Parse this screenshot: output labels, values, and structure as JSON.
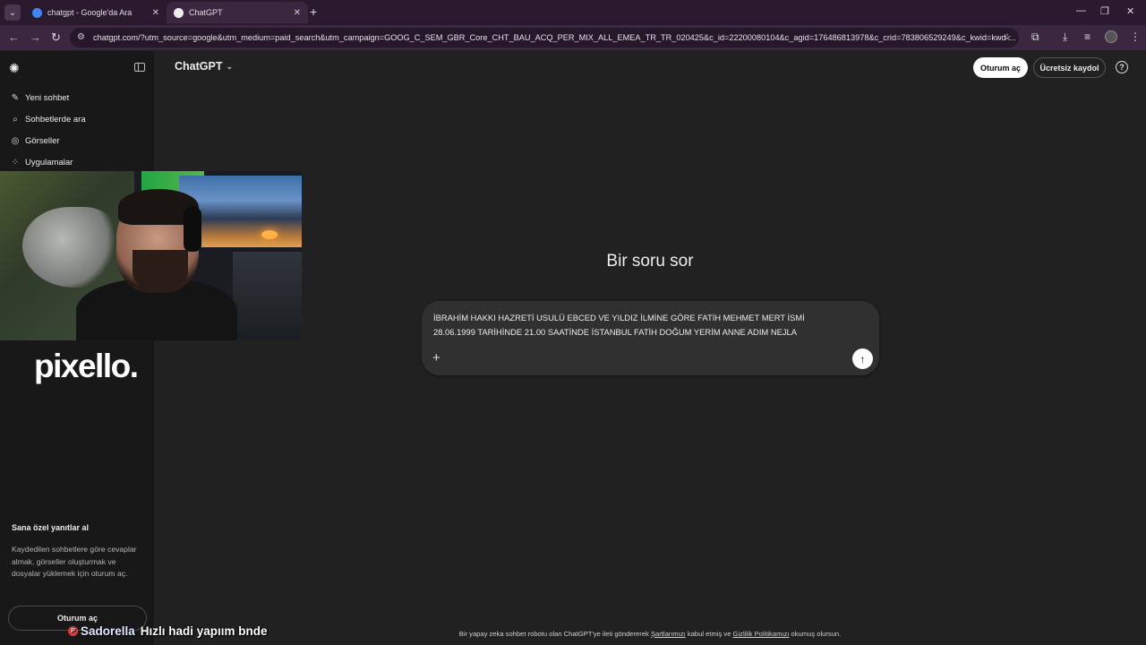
{
  "browser": {
    "tabs": [
      {
        "title": "chatgpt - Google'da Ara",
        "favicon_color": "#4285f4"
      },
      {
        "title": "ChatGPT",
        "favicon_color": "#ececec"
      }
    ],
    "url": "chatgpt.com/?utm_source=google&utm_medium=paid_search&utm_campaign=GOOG_C_SEM_GBR_Core_CHT_BAU_ACQ_PER_MIX_ALL_EMEA_TR_TR_020425&c_id=22200080104&c_agid=176486813978&c_crid=783806529249&c_kwid=kwd-...",
    "accent_color": "#3b2840"
  },
  "sidebar": {
    "items": [
      {
        "label": "Yeni sohbet",
        "icon": "edit-icon"
      },
      {
        "label": "Sohbetlerde ara",
        "icon": "search-icon"
      },
      {
        "label": "Görseller",
        "icon": "images-icon"
      },
      {
        "label": "Uygulamalar",
        "icon": "apps-icon"
      }
    ],
    "promo_title": "Sana özel yanıtlar al",
    "promo_text": "Kaydedilen sohbetlere göre cevaplar almak, görseller oluşturmak ve dosyalar yüklemek için oturum aç.",
    "login_label": "Oturum aç"
  },
  "overlay": {
    "brand": "pixello.",
    "chat_user": "Sadorella",
    "chat_message": "Hızlı hadi yapıım bnde"
  },
  "header": {
    "model_name": "ChatGPT",
    "login_label": "Oturum aç",
    "signup_label": "Ücretsiz kaydol"
  },
  "main": {
    "headline": "Bir soru sor",
    "composer_text": "İBRAHİM HAKKI HAZRETİ USULÜ EBCED VE YILDIZ İLMİNE GÖRE FATİH MEHMET MERT İSMİ 28.06.1999 TARİHİNDE 21.00 SAATİNDE İSTANBUL FATİH DOĞUM YERİM ANNE ADIM NEJLA"
  },
  "footer": {
    "prefix": "Bir yapay zeka sohbet robotu olan ChatGPT'ye ileti göndererek ",
    "terms_link": "Şartlarımızı",
    "middle": " kabul etmiş ve ",
    "privacy_link": "Gizlilik Politikamızı",
    "suffix": " okumuş olursun."
  }
}
